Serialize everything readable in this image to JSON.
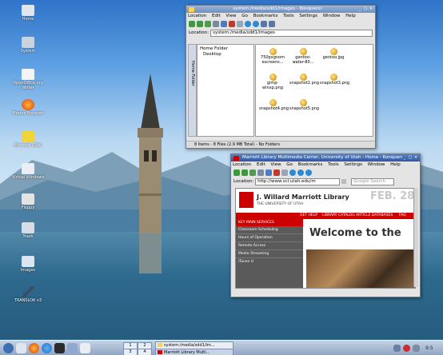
{
  "colors": {
    "utah_red": "#cc0000",
    "kde_title_active": "#3257a0",
    "kde_title_inactive": "#6f8fbd"
  },
  "desktop": {
    "icons": [
      {
        "label": "Home",
        "icon": "home-icon"
      },
      {
        "label": "System",
        "icon": "computer-icon"
      },
      {
        "label": "OpenOffice.org Writer",
        "icon": "document-icon"
      },
      {
        "label": "Firefox Browser",
        "icon": "firefox-icon"
      },
      {
        "label": "Ethereal (Gtk)",
        "icon": "network-icon"
      },
      {
        "label": "Virtual Windows",
        "icon": "window-icon"
      },
      {
        "label": "Floppy",
        "icon": "floppy-icon"
      },
      {
        "label": "Trash",
        "icon": "trash-icon"
      },
      {
        "label": "Images",
        "icon": "folder-icon"
      },
      {
        "label": "TRANSLOK v3",
        "icon": "pen-icon"
      }
    ]
  },
  "konqueror": {
    "title": "system:/media/sdd1/images - Konqueror",
    "menu": [
      "Location",
      "Edit",
      "View",
      "Go",
      "Bookmarks",
      "Tools",
      "Settings",
      "Window",
      "Help"
    ],
    "location_label": "Location:",
    "location_value": "system:/media/sdd1/images",
    "sidebar_tab": "Home Folder",
    "tree": [
      "Home Folder",
      "Desktop"
    ],
    "files": [
      {
        "name": "750pxgnom escreens..."
      },
      {
        "name": "gentoo-water-80..."
      },
      {
        "name": "gentoo.jpg"
      },
      {
        "name": "gimp-winxp.png"
      },
      {
        "name": "snapshot2.png"
      },
      {
        "name": "snapshot3.png"
      },
      {
        "name": "snapshot4.png"
      },
      {
        "name": "snapshot5.png"
      }
    ],
    "status": "8 Items - 8 Files (2.9 MB Total) - No Folders"
  },
  "browser": {
    "title": "Marriott Library Multimedia Center, University of Utah - Home - Konqueror",
    "menu": [
      "Location",
      "Edit",
      "View",
      "Go",
      "Bookmarks",
      "Tools",
      "Settings",
      "Window",
      "Help"
    ],
    "location_label": "Location:",
    "location_value": "http://www.scl.utah.edu/m",
    "search_placeholder": "Google Search",
    "page": {
      "library_name": "J. Willard Marriott Library",
      "university": "THE UNIVERSITY OF UTAH",
      "date_graphic": "FEB. 28",
      "topnav": [
        "GET HELP",
        "LIBRARY CATALOG",
        "ARTICLE DATABASES",
        "FAQ"
      ],
      "sidebar_heading": "KEY MAIN SERVICES",
      "sidebar_links": [
        "Classroom Scheduling",
        "Hours of Operation",
        "Remote Access",
        "Media Streaming",
        "iTunes U"
      ],
      "welcome": "Welcome to the"
    }
  },
  "taskbar": {
    "launchers": [
      "kde-menu-icon",
      "home-icon",
      "firefox-icon",
      "konqueror-icon",
      "terminal-icon",
      "desktop-icon",
      "window-icon"
    ],
    "pager": [
      "1",
      "2",
      "3",
      "4"
    ],
    "tasks": [
      {
        "label": "system:/media/sdd1/im..."
      },
      {
        "label": "Marriott Library Multi..."
      }
    ],
    "clock": "9:5"
  }
}
